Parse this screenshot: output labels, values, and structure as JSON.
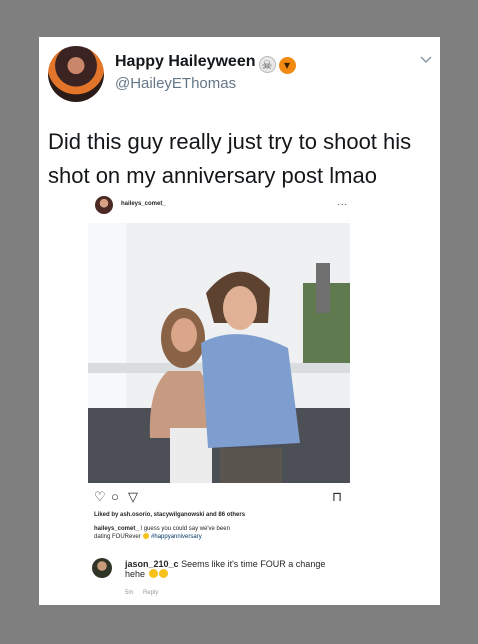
{
  "tweet": {
    "display_name": "Happy Haileyween",
    "handle": "@HaileyEThomas",
    "text": "Did this guy really just try to shoot his shot on my anniversary post lmao",
    "name_emojis": [
      "skull-emoji",
      "jack-o-lantern-emoji"
    ],
    "menu_icon": "chevron-down-icon"
  },
  "instagram": {
    "username": "haileys_comet_",
    "more": "...",
    "likes": "Liked by ash.osorio, stacywilganowski and 86 others",
    "caption_user": "haileys_comet_",
    "caption_text": "I guess you could say we've been dating FOURever",
    "caption_hashtag": "#happyanniversary",
    "comment_user": "jason_210_c",
    "comment_text": "Seems like it's time FOUR a change hehe",
    "comment_time": "5m",
    "reply_label": "Reply",
    "action_icons": [
      "heart-icon",
      "comment-icon",
      "share-icon",
      "bookmark-icon"
    ]
  }
}
